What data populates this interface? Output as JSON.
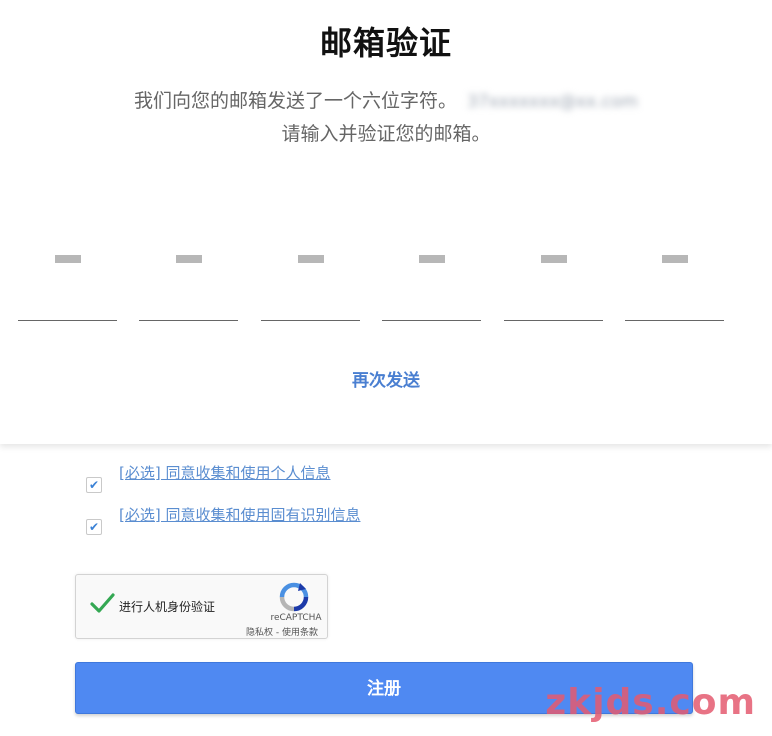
{
  "page": {
    "title": "邮箱验证"
  },
  "description": {
    "line1": "我们向您的邮箱发送了一个六位字符。",
    "email_masked": "37xxxxxxx@xx.com",
    "line2": "请输入并验证您的邮箱。"
  },
  "code": {
    "cells": [
      "",
      "",
      "",
      "",
      "",
      ""
    ]
  },
  "resend": {
    "label": "再次发送"
  },
  "agreements": [
    {
      "checked": true,
      "label": "[必选] 同意收集和使用个人信息"
    },
    {
      "checked": true,
      "label": "[必选] 同意收集和使用固有识别信息"
    }
  ],
  "captcha": {
    "label": "进行人机身份验证",
    "brand": "reCAPTCHA",
    "terms": "隐私权 - 使用条款",
    "checkmark": "✓",
    "check_color": "#34a853"
  },
  "register": {
    "label": "注册",
    "color": "#4f89f2"
  },
  "watermark": "zkjds.com",
  "colors": {
    "accent": "#4a7fd1",
    "link": "#5a8dd0"
  }
}
